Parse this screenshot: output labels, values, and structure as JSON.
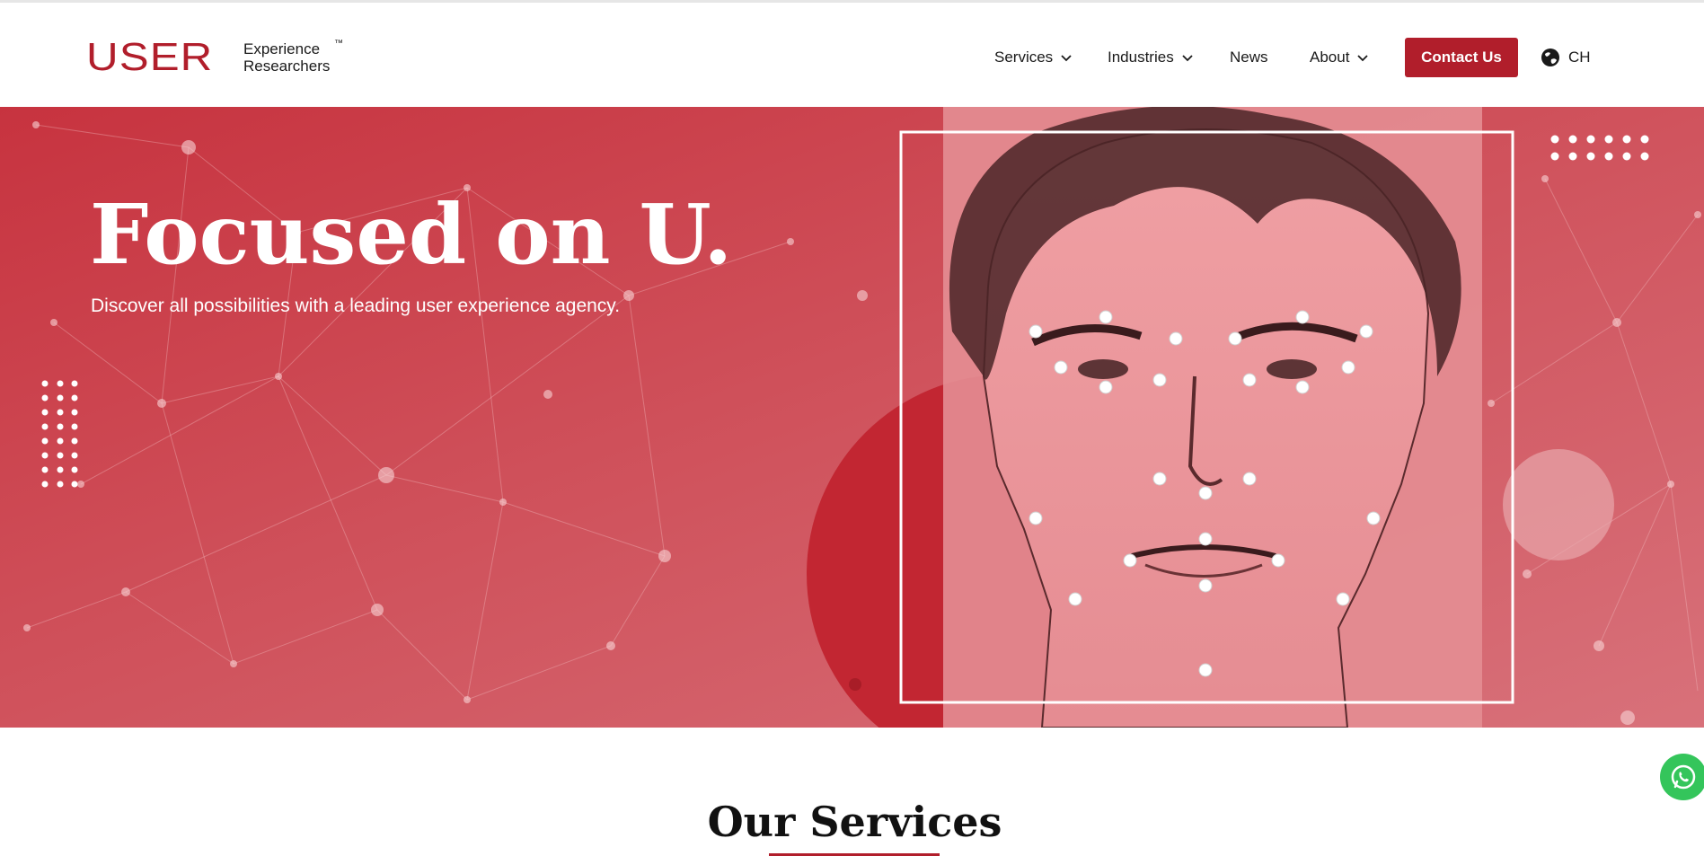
{
  "header": {
    "logo_mark": "USER",
    "logo_line1": "Experience",
    "logo_line2": "Researchers",
    "logo_tm": "™",
    "nav": [
      {
        "label": "Services",
        "has_dropdown": true
      },
      {
        "label": "Industries",
        "has_dropdown": true
      },
      {
        "label": "News",
        "has_dropdown": false
      },
      {
        "label": "About",
        "has_dropdown": true
      }
    ],
    "contact_label": "Contact Us",
    "lang_label": "CH",
    "lang_icon": "globe-icon"
  },
  "hero": {
    "title": "Focused on U.",
    "subtitle": "Discover all possibilities with a leading user experience agency.",
    "image": "face-landmarks-illustration"
  },
  "services": {
    "title": "Our Services"
  },
  "floating": {
    "whatsapp_icon": "whatsapp-icon"
  },
  "colors": {
    "brand": "#b11e2b",
    "hero_bg": "#c94650",
    "whatsapp": "#34c55b"
  }
}
